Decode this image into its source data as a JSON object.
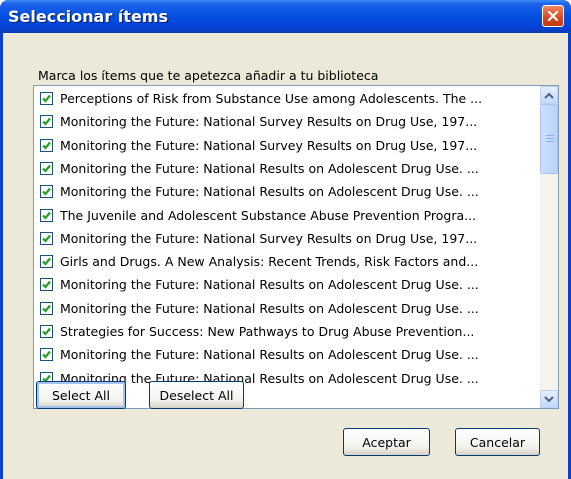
{
  "window": {
    "title": "Seleccionar ítems"
  },
  "prompt": "Marca los ítems que te apetezca añadir a tu biblioteca",
  "items": [
    {
      "label": "Perceptions of Risk from Substance Use among Adolescents. The ...",
      "checked": true
    },
    {
      "label": "Monitoring the Future: National Survey Results on Drug Use, 197...",
      "checked": true
    },
    {
      "label": "Monitoring the Future: National Survey Results on Drug Use, 197...",
      "checked": true
    },
    {
      "label": "Monitoring the Future: National Results on Adolescent Drug Use. ...",
      "checked": true
    },
    {
      "label": "Monitoring the Future: National Results on Adolescent Drug Use. ...",
      "checked": true
    },
    {
      "label": "The Juvenile and Adolescent Substance Abuse Prevention Progra...",
      "checked": true
    },
    {
      "label": "Monitoring the Future: National Survey Results on Drug Use, 197...",
      "checked": true
    },
    {
      "label": "Girls and Drugs. A New Analysis: Recent Trends, Risk Factors and...",
      "checked": true
    },
    {
      "label": "Monitoring the Future: National Results on Adolescent Drug Use. ...",
      "checked": true
    },
    {
      "label": "Monitoring the Future: National Results on Adolescent Drug Use. ...",
      "checked": true
    },
    {
      "label": "Strategies for Success: New Pathways to Drug Abuse Prevention...",
      "checked": true
    },
    {
      "label": "Monitoring the Future: National Results on Adolescent Drug Use. ...",
      "checked": true
    },
    {
      "label": "Monitoring the Future: National Results on Adolescent Drug Use. ...",
      "checked": true
    }
  ],
  "buttons": {
    "select_all": "Select All",
    "deselect_all": "Deselect All",
    "accept": "Aceptar",
    "cancel": "Cancelar"
  },
  "colors": {
    "titlebar": "#0551e1",
    "client_bg": "#ece9d8",
    "check": "#21a121",
    "close": "#d8481e"
  }
}
